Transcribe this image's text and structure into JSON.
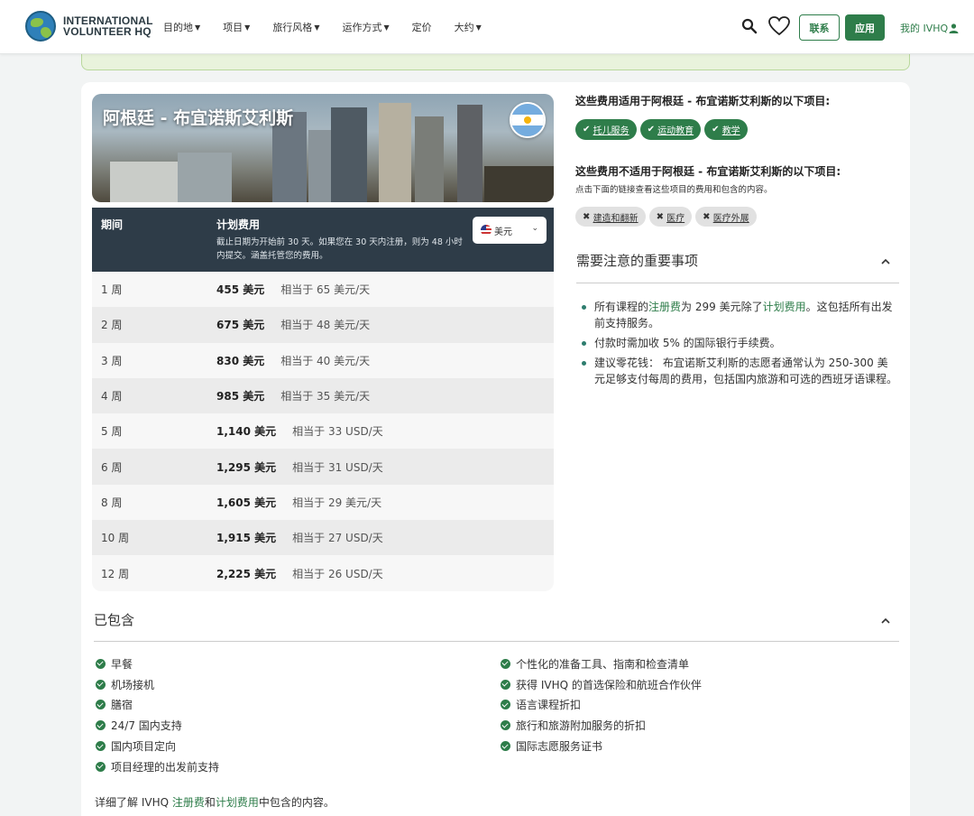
{
  "header": {
    "logo_line1": "INTERNATIONAL",
    "logo_line2": "VOLUNTEER HQ",
    "nav": [
      {
        "label": "目的地"
      },
      {
        "label": "项目"
      },
      {
        "label": "旅行风格"
      },
      {
        "label": "运作方式"
      },
      {
        "label": "定价"
      },
      {
        "label": "大约"
      }
    ],
    "contact_label": "联系",
    "apply_label": "应用",
    "my_ivhq_label": "我的 IVHQ"
  },
  "hero": {
    "title": "阿根廷 - 布宜诺斯艾利斯"
  },
  "price_table": {
    "col_period": "期间",
    "col_cost": "计划费用",
    "note": "截止日期为开始前 30 天。如果您在 30 天内注册，则为 48 小时内提交。涵盖托管您的费用。",
    "currency": "美元",
    "rows": [
      {
        "duration": "1 周",
        "price": "455 美元",
        "per_day": "相当于 65 美元/天"
      },
      {
        "duration": "2 周",
        "price": "675 美元",
        "per_day": "相当于 48 美元/天"
      },
      {
        "duration": "3 周",
        "price": "830 美元",
        "per_day": "相当于 40 美元/天"
      },
      {
        "duration": "4 周",
        "price": "985 美元",
        "per_day": "相当于 35 美元/天"
      },
      {
        "duration": "5 周",
        "price": "1,140 美元",
        "per_day": "相当于 33 USD/天"
      },
      {
        "duration": "6 周",
        "price": "1,295 美元",
        "per_day": "相当于 31 USD/天"
      },
      {
        "duration": "8 周",
        "price": "1,605 美元",
        "per_day": "相当于 29 美元/天"
      },
      {
        "duration": "10 周",
        "price": "1,915 美元",
        "per_day": "相当于 27 USD/天"
      },
      {
        "duration": "12 周",
        "price": "2,225 美元",
        "per_day": "相当于 26 USD/天"
      }
    ]
  },
  "applies": {
    "title": "这些费用适用于阿根廷 - 布宜诺斯艾利斯的以下项目:",
    "tags": [
      "托儿服务",
      "运动教育",
      "教学"
    ]
  },
  "not_applies": {
    "title": "这些费用不适用于阿根廷 - 布宜诺斯艾利斯的以下项目:",
    "subtitle": "点击下面的链接查看这些项目的费用和包含的内容。",
    "tags": [
      "建造和翻新",
      "医疗",
      "医疗外展"
    ]
  },
  "important": {
    "title": "需要注意的重要事项",
    "item1_pre": "所有课程的",
    "item1_link1": "注册费",
    "item1_mid": "为 299 美元除了",
    "item1_link2": "计划费用",
    "item1_post": "。这包括所有出发前支持服务。",
    "item2": "付款时需加收 5% 的国际银行手续费。",
    "item3": "建议零花钱： 布宜诺斯艾利斯的志愿者通常认为 250-300 美元足够支付每周的费用，包括国内旅游和可选的西班牙语课程。"
  },
  "included": {
    "title": "已包含",
    "left": [
      "早餐",
      "机场接机",
      "膳宿",
      "24/7 国内支持",
      "国内项目定向",
      "项目经理的出发前支持"
    ],
    "right": [
      "个性化的准备工具、指南和检查清单",
      "获得 IVHQ 的首选保险和航班合作伙伴",
      "语言课程折扣",
      "旅行和旅游附加服务的折扣",
      "国际志愿服务证书"
    ],
    "learn_pre": "详细了解 IVHQ ",
    "learn_link1": "注册费",
    "learn_mid": "和",
    "learn_link2": "计划费用",
    "learn_post": "中包含的内容。"
  }
}
